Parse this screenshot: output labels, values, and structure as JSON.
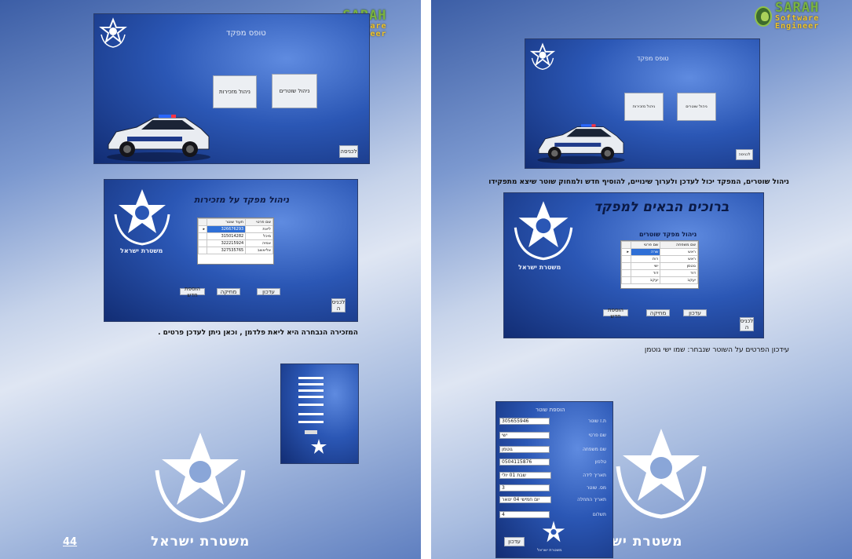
{
  "logo": {
    "line1": "SARAH",
    "line2": "Software Engineer"
  },
  "left_page": {
    "shot1": {
      "title": "טופס מפקד",
      "btn_cars": "ניהול מזכירות",
      "btn_officers": "ניהול שוטרים",
      "btn_enter": "לכניסה"
    },
    "shot2": {
      "title": "ניהול מפקד על מזכירות",
      "emblem_caption": "משטרת ישראל",
      "columns": [
        "שם פרטי",
        "תעוד שוטר"
      ],
      "rows": [
        {
          "name": "ליאת",
          "id": "326676293"
        },
        {
          "name": "מיכל",
          "id": "315014282"
        },
        {
          "name": "אמיה",
          "id": "322215924"
        },
        {
          "name": "אליאשב",
          "id": "327535765"
        }
      ],
      "btn_new": "הוספת חדש",
      "btn_delete": "מחיקה",
      "btn_update": "עדכון",
      "btn_enter": "לכניס ה"
    },
    "caption": "המזכירה הנבחרה היא ליאת פלדמן , וכאן ניתן לעדכן פרטים .",
    "footer_name": "משטרת ישראל",
    "page_number": "44"
  },
  "right_page": {
    "shot1": {
      "title": "טופס מפקד",
      "btn_cars": "ניהול מזכירות",
      "btn_officers": "ניהול שוטרים",
      "btn_enter": "לכניסה"
    },
    "caption1": "ניהול שוטרים, המפקד יכול לעדכן ולערוך שינויים, להוסיף חדש ולמחוק שוטר שיצא מתפקידו",
    "shot2": {
      "heading": "ברוכים הבאים למפקד",
      "title": "ניהול מפקד שוטרים",
      "emblem_caption": "משטרת ישראל",
      "columns": [
        "שם משפחה",
        "שם פרטי"
      ],
      "rows": [
        {
          "last": "ראש",
          "first": "שרה"
        },
        {
          "last": "ראש",
          "first": "רות"
        },
        {
          "last": "גוטמן",
          "first": "ישי"
        },
        {
          "last": "דוד",
          "first": "דוד"
        },
        {
          "last": "יעקב",
          "first": "יעקב"
        }
      ],
      "btn_new": "הוספת חדש",
      "btn_delete": "מחיקה",
      "btn_update": "עדכון",
      "btn_enter": "לכניס ה"
    },
    "caption2": "עידכון הפרטים על השוטר שנבחר: שמו ישי גוטמן",
    "form": {
      "title": "הוספת שוטר",
      "fields": [
        {
          "label": "ת.ז שוטר",
          "value": "305655946"
        },
        {
          "label": "שם פרטי",
          "value": "ישי"
        },
        {
          "label": "שם משפחה",
          "value": "גוטמן"
        },
        {
          "label": "טלפון",
          "value": "0504115876"
        },
        {
          "label": "תאריך לידה",
          "value": "שבת 01 יולי"
        },
        {
          "label": "מס. שוטר",
          "value": "3"
        },
        {
          "label": "תאריך התחלה",
          "value": "יום חמישי 04 ינואר"
        },
        {
          "label": "תשלום",
          "value": "4"
        }
      ],
      "btn_update": "עדכון",
      "emblem_caption": "משטרת ישראל"
    },
    "footer_name": "משטרת יש"
  }
}
